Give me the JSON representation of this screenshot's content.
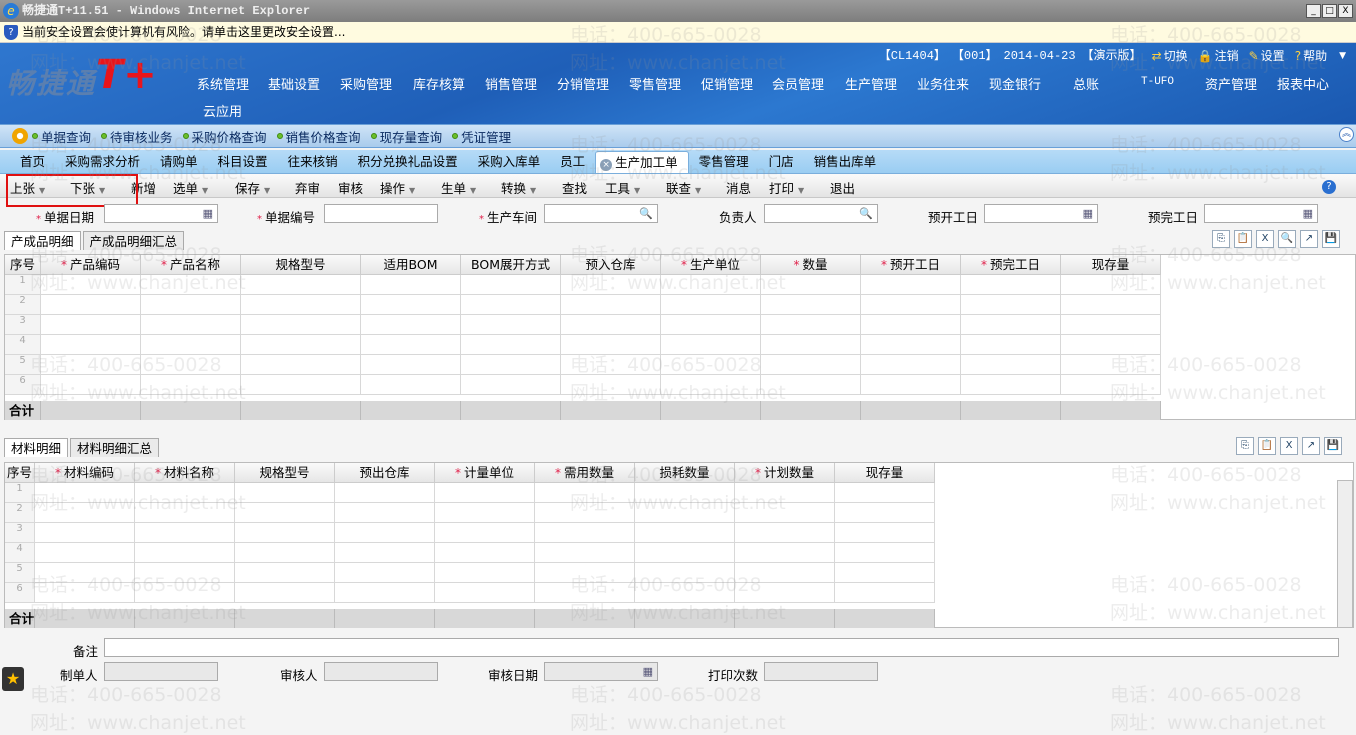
{
  "window": {
    "title": "畅捷通T+11.51 - Windows Internet Explorer",
    "buttons": [
      "_",
      "□",
      "X"
    ]
  },
  "infobar": {
    "text": "当前安全设置会使计算机有风险。请单击这里更改安全设置..."
  },
  "header": {
    "logo": "畅捷通",
    "logo_mark": "T+",
    "info": [
      "【CL1404】",
      "【001】",
      "2014-04-23",
      "【演示版】"
    ],
    "actions": [
      {
        "label": "切换",
        "icon": "switch-icon"
      },
      {
        "label": "注销",
        "icon": "lock-icon"
      },
      {
        "label": "设置",
        "icon": "settings-icon"
      },
      {
        "label": "帮助",
        "icon": "help-icon"
      }
    ],
    "menu": [
      "系统管理",
      "基础设置",
      "采购管理",
      "库存核算",
      "销售管理",
      "分销管理",
      "零售管理",
      "促销管理",
      "会员管理",
      "生产管理",
      "业务往来",
      "现金银行",
      "总账",
      "T-UFO",
      "资产管理",
      "报表中心"
    ],
    "menu2": [
      "云应用"
    ]
  },
  "quicklinks": [
    "单据查询",
    "待审核业务",
    "采购价格查询",
    "销售价格查询",
    "现存量查询",
    "凭证管理"
  ],
  "tabs": [
    "首页",
    "采购需求分析",
    "请购单",
    "科目设置",
    "往来核销",
    "积分兑换礼品设置",
    "采购入库单",
    "员工",
    "生产加工单",
    "零售管理",
    "门店",
    "销售出库单"
  ],
  "active_tab": "生产加工单",
  "toolbar": [
    {
      "label": "上张",
      "dd": true
    },
    {
      "label": "下张",
      "dd": true
    },
    {
      "label": "新增"
    },
    {
      "label": "选单",
      "dd": true
    },
    {
      "label": "保存",
      "dd": true
    },
    {
      "label": "弃审"
    },
    {
      "label": "审核"
    },
    {
      "label": "操作",
      "dd": true
    },
    {
      "label": "生单",
      "dd": true
    },
    {
      "label": "转换",
      "dd": true
    },
    {
      "label": "查找"
    },
    {
      "label": "工具",
      "dd": true
    },
    {
      "label": "联查",
      "dd": true
    },
    {
      "label": "消息"
    },
    {
      "label": "打印",
      "dd": true
    },
    {
      "label": "退出"
    }
  ],
  "form": {
    "date": "单据日期",
    "code": "单据编号",
    "workshop": "生产车间",
    "owner": "负责人",
    "start": "预开工日",
    "finish": "预完工日"
  },
  "grid1": {
    "tabs": [
      "产成品明细",
      "产成品明细汇总"
    ],
    "columns": [
      {
        "t": "序号"
      },
      {
        "t": "产品编码",
        "r": 1
      },
      {
        "t": "产品名称",
        "r": 1
      },
      {
        "t": "规格型号"
      },
      {
        "t": "适用BOM"
      },
      {
        "t": "BOM展开方式"
      },
      {
        "t": "预入仓库"
      },
      {
        "t": "生产单位",
        "r": 1
      },
      {
        "t": "数量",
        "r": 1
      },
      {
        "t": "预开工日",
        "r": 1
      },
      {
        "t": "预完工日",
        "r": 1
      },
      {
        "t": "现存量"
      }
    ],
    "rows": [
      "1",
      "2",
      "3",
      "4",
      "5",
      "6"
    ],
    "total": "合计"
  },
  "grid2": {
    "tabs": [
      "材料明细",
      "材料明细汇总"
    ],
    "columns": [
      {
        "t": "序号"
      },
      {
        "t": "材料编码",
        "r": 1
      },
      {
        "t": "材料名称",
        "r": 1
      },
      {
        "t": "规格型号"
      },
      {
        "t": "预出仓库"
      },
      {
        "t": "计量单位",
        "r": 1
      },
      {
        "t": "需用数量",
        "r": 1
      },
      {
        "t": "损耗数量"
      },
      {
        "t": "计划数量",
        "r": 1
      },
      {
        "t": "现存量"
      }
    ],
    "rows": [
      "1",
      "2",
      "3",
      "4",
      "5",
      "6"
    ],
    "total": "合计"
  },
  "footer": {
    "remark": "备注",
    "maker": "制单人",
    "auditor": "审核人",
    "audit_date": "审核日期",
    "print_count": "打印次数"
  },
  "watermark": {
    "phone": "电话：400-665-0028",
    "site": "网址：www.chanjet.net"
  },
  "colors": {
    "header": "#1f5fb8",
    "highlight": "#e01010"
  }
}
